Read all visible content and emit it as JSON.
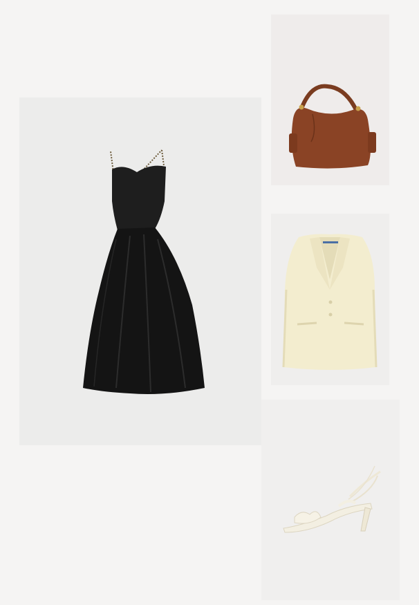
{
  "collage": {
    "background_color": "#f5f4f3",
    "items": [
      {
        "id": "dress",
        "kind": "black-midi-dress",
        "color": "#1b1b1b",
        "tile_color": "#ececeb"
      },
      {
        "id": "bag",
        "kind": "brown-leather-handbag",
        "color": "#8a4325",
        "tile_color": "#efeceb"
      },
      {
        "id": "blazer",
        "kind": "cream-blazer",
        "color": "#f3edcf",
        "tile_color": "#efeeed"
      },
      {
        "id": "sandal",
        "kind": "ivory-heeled-sandal",
        "color": "#f3efe2",
        "tile_color": "#f0efee"
      }
    ]
  }
}
